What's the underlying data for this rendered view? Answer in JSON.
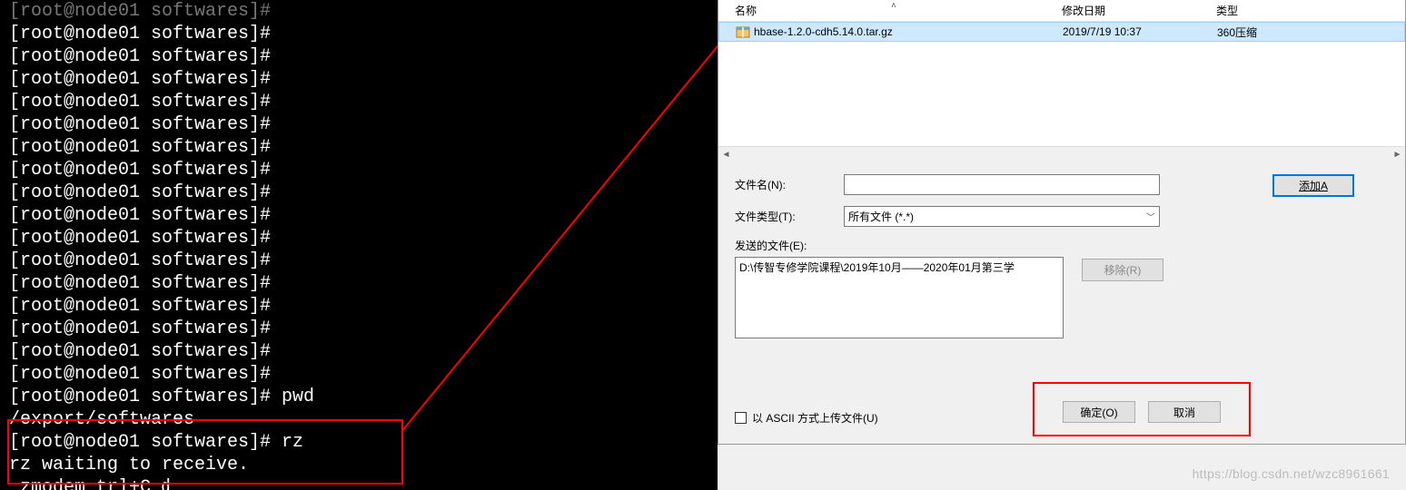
{
  "terminal": {
    "prompt": "[root@node01 softwares]#",
    "lines_count": 18,
    "pwd_cmd": "pwd",
    "pwd_output": "/export/softwares",
    "rz_cmd": "rz",
    "rz_line1": "rz waiting to receive.",
    "rz_line2": " zmodem trl+C ȡ"
  },
  "dialog": {
    "columns": {
      "name": "名称",
      "date": "修改日期",
      "type": "类型"
    },
    "row": {
      "filename": "hbase-1.2.0-cdh5.14.0.tar.gz",
      "date": "2019/7/19 10:37",
      "type": "360压缩"
    },
    "filename_label": "文件名(N):",
    "filetype_label": "文件类型(T):",
    "filetype_value": "所有文件 (*.*)",
    "sendfiles_label": "发送的文件(E):",
    "send_path": "D:\\传智专修学院课程\\2019年10月——2020年01月第三学",
    "add_btn": "添加A",
    "remove_btn": "移除(R)",
    "ascii_checkbox": "以 ASCII 方式上传文件(U)",
    "ok_btn": "确定(O)",
    "cancel_btn": "取消"
  },
  "watermark": "https://blog.csdn.net/wzc8961661"
}
